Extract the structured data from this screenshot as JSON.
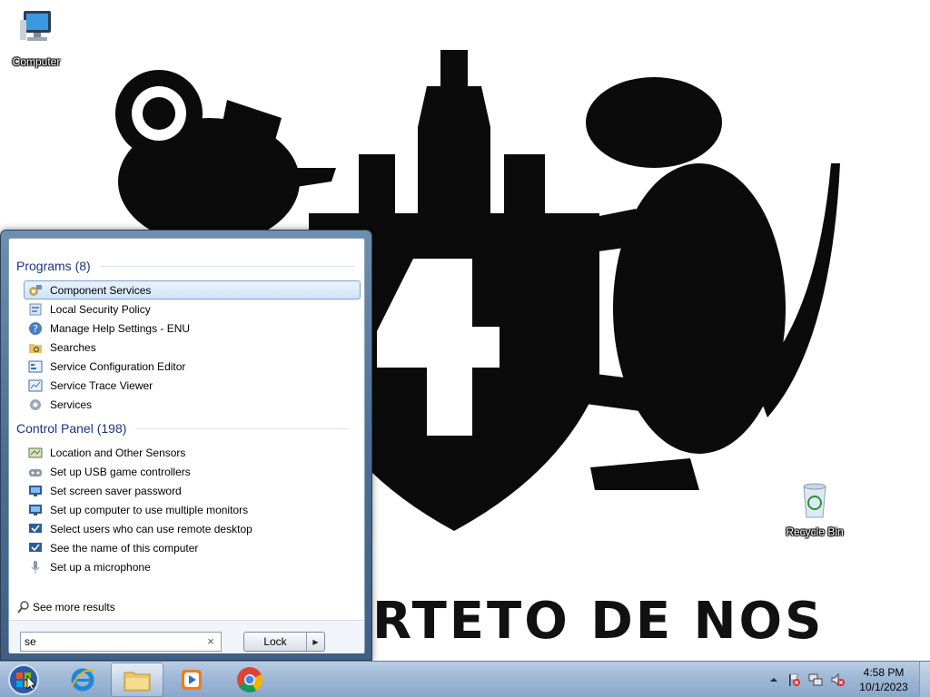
{
  "desktop": {
    "wallpaper_text": "RTETO DE NOS",
    "icons": [
      {
        "label": "Computer",
        "icon": "computer-icon"
      },
      {
        "label": "Recycle Bin",
        "icon": "recycle-bin-icon"
      }
    ]
  },
  "start_menu": {
    "groups": [
      {
        "header": "Programs (8)",
        "items": [
          {
            "label": "Component Services",
            "icon": "component-services-icon",
            "selected": true
          },
          {
            "label": "Local Security Policy",
            "icon": "security-policy-icon"
          },
          {
            "label": "Manage Help Settings - ENU",
            "icon": "help-settings-icon"
          },
          {
            "label": "Searches",
            "icon": "searches-folder-icon"
          },
          {
            "label": "Service Configuration Editor",
            "icon": "config-editor-icon"
          },
          {
            "label": "Service Trace Viewer",
            "icon": "trace-viewer-icon"
          },
          {
            "label": "Services",
            "icon": "services-gear-icon"
          }
        ]
      },
      {
        "header": "Control Panel (198)",
        "items": [
          {
            "label": "Location and Other Sensors",
            "icon": "sensors-icon"
          },
          {
            "label": "Set up USB game controllers",
            "icon": "game-controller-icon"
          },
          {
            "label": "Set screen saver password",
            "icon": "screen-saver-icon"
          },
          {
            "label": "Set up computer to use multiple monitors",
            "icon": "monitors-icon"
          },
          {
            "label": "Select users who can use remote desktop",
            "icon": "remote-desktop-icon"
          },
          {
            "label": "See the name of this computer",
            "icon": "computer-name-icon"
          },
          {
            "label": "Set up a microphone",
            "icon": "microphone-icon"
          }
        ]
      }
    ],
    "see_more": "See more results",
    "search": {
      "value": "se",
      "clear_symbol": "×"
    },
    "power": {
      "label": "Lock",
      "arrow": "▶"
    }
  },
  "taskbar": {
    "pinned": [
      {
        "name": "internet-explorer",
        "icon": "internet-explorer-icon",
        "active": false
      },
      {
        "name": "windows-explorer",
        "icon": "folder-icon",
        "active": true
      },
      {
        "name": "media-player",
        "icon": "media-player-icon",
        "active": false
      },
      {
        "name": "chrome",
        "icon": "chrome-icon",
        "active": false
      }
    ],
    "tray_icons": [
      "show-hidden-icons-arrow",
      "action-center-flag-icon",
      "network-icon",
      "volume-muted-icon"
    ],
    "clock": {
      "time": "4:58 PM",
      "date": "10/1/2023"
    }
  },
  "colors": {
    "header_blue": "#1e3287",
    "selection_fill": "#cfe3fa",
    "selection_border": "#7da2ce",
    "taskbar": "#9fb8d6"
  }
}
